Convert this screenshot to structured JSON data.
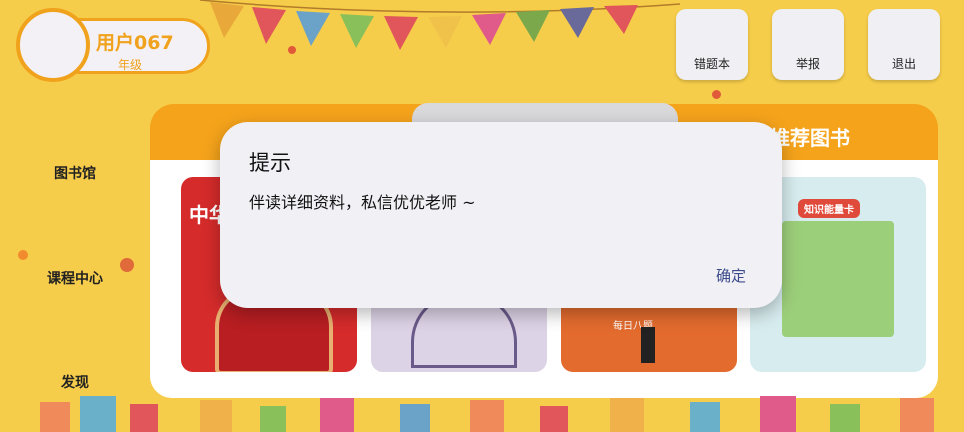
{
  "user": {
    "name": "用户067",
    "grade": "年级"
  },
  "top_buttons": [
    {
      "label": "错题本"
    },
    {
      "label": "举报"
    },
    {
      "label": "退出"
    }
  ],
  "sidebar": {
    "items": [
      {
        "label": "图书馆"
      },
      {
        "label": "课程中心"
      },
      {
        "label": "发现"
      }
    ]
  },
  "panel": {
    "tab_label": "推荐图书"
  },
  "books": [
    {
      "cover_text": "中华",
      "theme": "#d52b2b"
    },
    {
      "cover_text": "",
      "theme": "#ddd3e6"
    },
    {
      "cover_text": "每日八题",
      "theme": "#e36b2e"
    },
    {
      "cover_text": "知识能量卡",
      "theme": "#d7ecef"
    }
  ],
  "dialog": {
    "title": "提示",
    "message": "伴读详细资料，私信优优老师 ~",
    "confirm_label": "确定"
  },
  "colors": {
    "background": "#f6cd4a",
    "accent": "#f0a21c",
    "dialog_bg": "#f1f0f5",
    "confirm_text": "#3b4a8a"
  }
}
